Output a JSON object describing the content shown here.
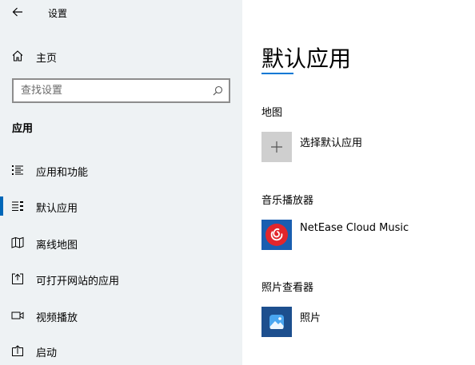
{
  "window": {
    "title": "设置"
  },
  "sidebar": {
    "home_label": "主页",
    "search": {
      "value": "",
      "placeholder": "查找设置"
    },
    "section_title": "应用",
    "items": [
      {
        "label": "应用和功能",
        "icon": "apps-features-icon",
        "active": false
      },
      {
        "label": "默认应用",
        "icon": "default-apps-icon",
        "active": true
      },
      {
        "label": "离线地图",
        "icon": "offline-maps-icon",
        "active": false
      },
      {
        "label": "可打开网站的应用",
        "icon": "apps-for-websites-icon",
        "active": false
      },
      {
        "label": "视频播放",
        "icon": "video-playback-icon",
        "active": false
      },
      {
        "label": "启动",
        "icon": "startup-icon",
        "active": false
      }
    ]
  },
  "main": {
    "title": "默认应用",
    "groups": [
      {
        "label": "地图",
        "app_name": "选择默认应用",
        "tile": "add-icon"
      },
      {
        "label": "音乐播放器",
        "app_name": "NetEase Cloud Music",
        "tile": "netease-cloud-music-icon"
      },
      {
        "label": "照片查看器",
        "app_name": "照片",
        "tile": "photos-app-icon"
      }
    ]
  },
  "colors": {
    "sidebar_background": "#eef2f4",
    "accent": "#0078d4",
    "netease_tile": "#1a5eb0",
    "netease_red": "#e2262b",
    "photos_tile": "#1d4f8e"
  }
}
